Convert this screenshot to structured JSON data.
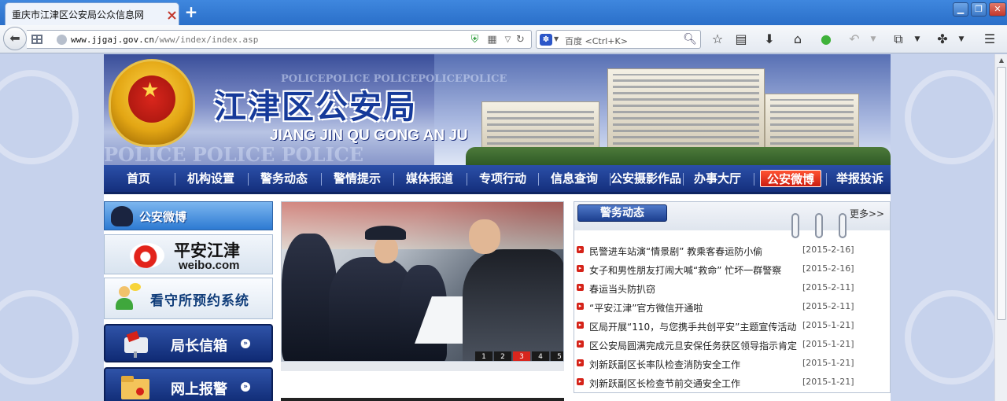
{
  "browser": {
    "tab_title": "重庆市江津区公安局公众信息网",
    "url_domain": "www.jjgaj.gov.cn",
    "url_path": "/www/index/index.asp",
    "search_engine": "百度",
    "search_shortcut": "<Ctrl+K>"
  },
  "banner": {
    "title": "江津区公安局",
    "subtitle": "JIANG JIN QU GONG AN JU",
    "watermark_top": "POLICEPOLICE POLICEPOLICEPOLICE",
    "watermark_bottom": "POLICE POLICE POLICE"
  },
  "nav": {
    "items": [
      {
        "label": "首页"
      },
      {
        "label": "机构设置"
      },
      {
        "label": "警务动态"
      },
      {
        "label": "警情提示"
      },
      {
        "label": "媒体报道"
      },
      {
        "label": "专项行动"
      },
      {
        "label": "信息查询"
      },
      {
        "label": "公安摄影作品"
      },
      {
        "label": "办事大厅"
      },
      {
        "label": "公安微博"
      },
      {
        "label": "举报投诉"
      }
    ],
    "active_index": 9
  },
  "sidebar": {
    "weibo_head": "公安微博",
    "weibo_name": "平安江津",
    "weibo_domain": "weibo.com",
    "kanshou": "看守所预约系统",
    "mailbox": "局长信箱",
    "report": "网上报警"
  },
  "slideshow": {
    "pages": [
      "1",
      "2",
      "3",
      "4",
      "5"
    ],
    "current": 3
  },
  "news": {
    "heading": "警务动态",
    "more": "更多>>",
    "items": [
      {
        "title": "民警进车站演“情景剧” 教乘客春运防小偷",
        "date": "[2015-2-16]"
      },
      {
        "title": "女子和男性朋友打闹大喊“救命” 忙坏一群警察",
        "date": "[2015-2-16]"
      },
      {
        "title": "春运当头防扒窃",
        "date": "[2015-2-11]"
      },
      {
        "title": "“平安江津”官方微信开通啦",
        "date": "[2015-2-11]"
      },
      {
        "title": "区局开展“110，与您携手共创平安”主题宣传活动",
        "date": "[2015-1-21]"
      },
      {
        "title": "区公安局圆满完成元旦安保任务获区领导指示肯定",
        "date": "[2015-1-21]"
      },
      {
        "title": "刘新跃副区长率队检查消防安全工作",
        "date": "[2015-1-21]"
      },
      {
        "title": "刘新跃副区长检查节前交通安全工作",
        "date": "[2015-1-21]"
      }
    ]
  },
  "colors": {
    "nav_bg": "#1d3d92",
    "nav_active": "#e0281a",
    "accent_red": "#d52218",
    "page_bg": "#c6d2ec"
  }
}
